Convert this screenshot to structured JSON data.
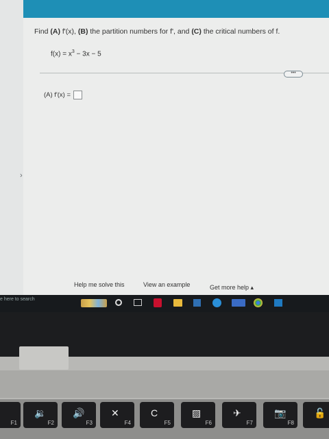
{
  "question": {
    "find_text": "Find",
    "part_a_label": "(A)",
    "part_a_text": "f'(x),",
    "part_b_label": "(B)",
    "part_b_text": "the partition numbers for f', and",
    "part_c_label": "(C)",
    "part_c_text": "the critical numbers of f."
  },
  "function": {
    "lhs": "f(x) = x",
    "exponent": "3",
    "rhs": " − 3x − 5"
  },
  "more_button": "•••",
  "answer_a": {
    "label": "(A) f'(x) ="
  },
  "footer": {
    "help_solve": "Help me solve this",
    "view_example": "View an example",
    "more_help": "Get more help ▴"
  },
  "taskbar": {
    "search_text": "e here to search"
  },
  "keys": [
    {
      "label": "F1",
      "symbol": ""
    },
    {
      "label": "F2",
      "symbol": "🔉"
    },
    {
      "label": "F3",
      "symbol": "🔊"
    },
    {
      "label": "F4",
      "symbol": "✕"
    },
    {
      "label": "F5",
      "symbol": "C"
    },
    {
      "label": "F6",
      "symbol": "▨"
    },
    {
      "label": "F7",
      "symbol": "✈"
    },
    {
      "label": "F8",
      "symbol": "📷"
    },
    {
      "label": "",
      "symbol": "🔓"
    }
  ],
  "colors": {
    "topbar": "#1e8fb6",
    "content_bg": "#ecedec",
    "taskbar": "#171a1d"
  }
}
